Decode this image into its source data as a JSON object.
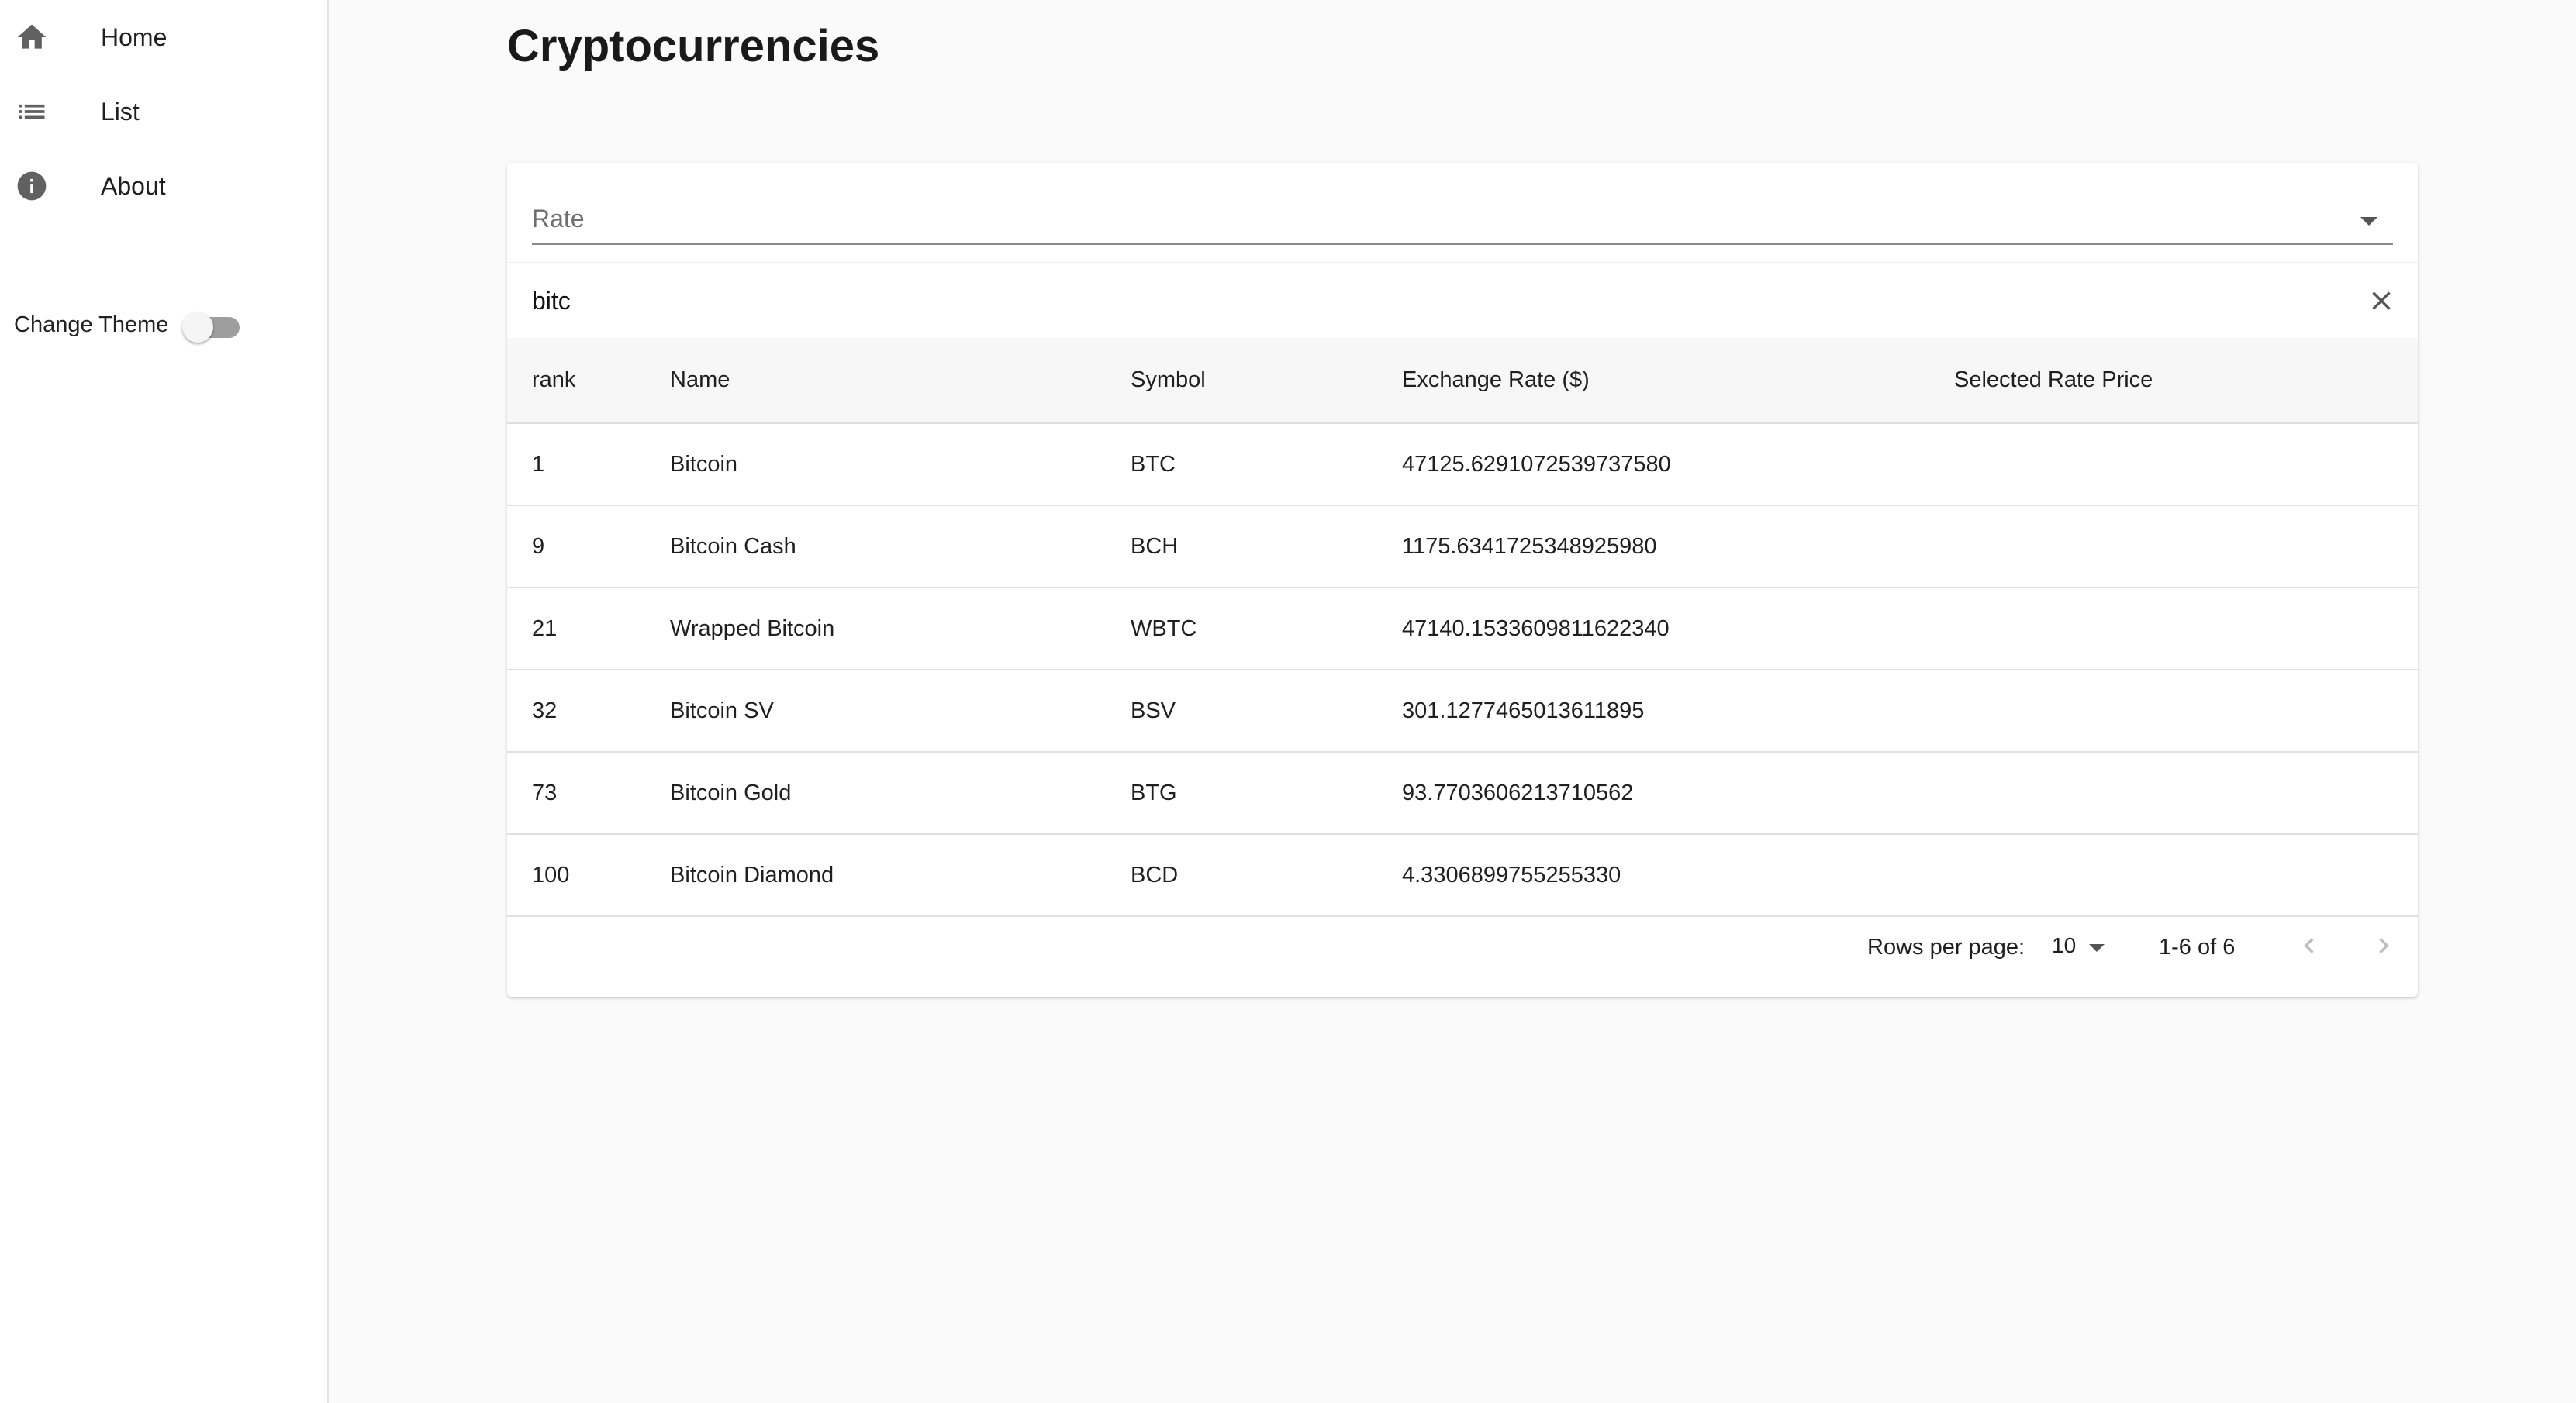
{
  "sidebar": {
    "items": [
      {
        "label": "Home",
        "icon": "home-icon"
      },
      {
        "label": "List",
        "icon": "list-icon"
      },
      {
        "label": "About",
        "icon": "info-icon"
      }
    ],
    "theme_toggle": {
      "label": "Change Theme",
      "checked": false
    }
  },
  "main": {
    "title": "Cryptocurrencies",
    "rate_select": {
      "placeholder": "Rate",
      "value": ""
    },
    "search": {
      "value": "bitc"
    },
    "table": {
      "columns": [
        "rank",
        "Name",
        "Symbol",
        "Exchange Rate ($)",
        "Selected Rate Price"
      ],
      "rows": [
        [
          "1",
          "Bitcoin",
          "BTC",
          "47125.6291072539737580",
          ""
        ],
        [
          "9",
          "Bitcoin Cash",
          "BCH",
          "1175.6341725348925980",
          ""
        ],
        [
          "21",
          "Wrapped Bitcoin",
          "WBTC",
          "47140.1533609811622340",
          ""
        ],
        [
          "32",
          "Bitcoin SV",
          "BSV",
          "301.1277465013611895",
          ""
        ],
        [
          "73",
          "Bitcoin Gold",
          "BTG",
          "93.7703606213710562",
          ""
        ],
        [
          "100",
          "Bitcoin Diamond",
          "BCD",
          "4.3306899755255330",
          ""
        ]
      ]
    },
    "pagination": {
      "rows_per_page_label": "Rows per page:",
      "rows_per_page": "10",
      "range": "1-6 of 6"
    }
  },
  "colors": {
    "background": "#fafafa",
    "sidebar_bg": "#ffffff",
    "icon": "#616161",
    "header_row_bg": "#f7f7f7"
  }
}
